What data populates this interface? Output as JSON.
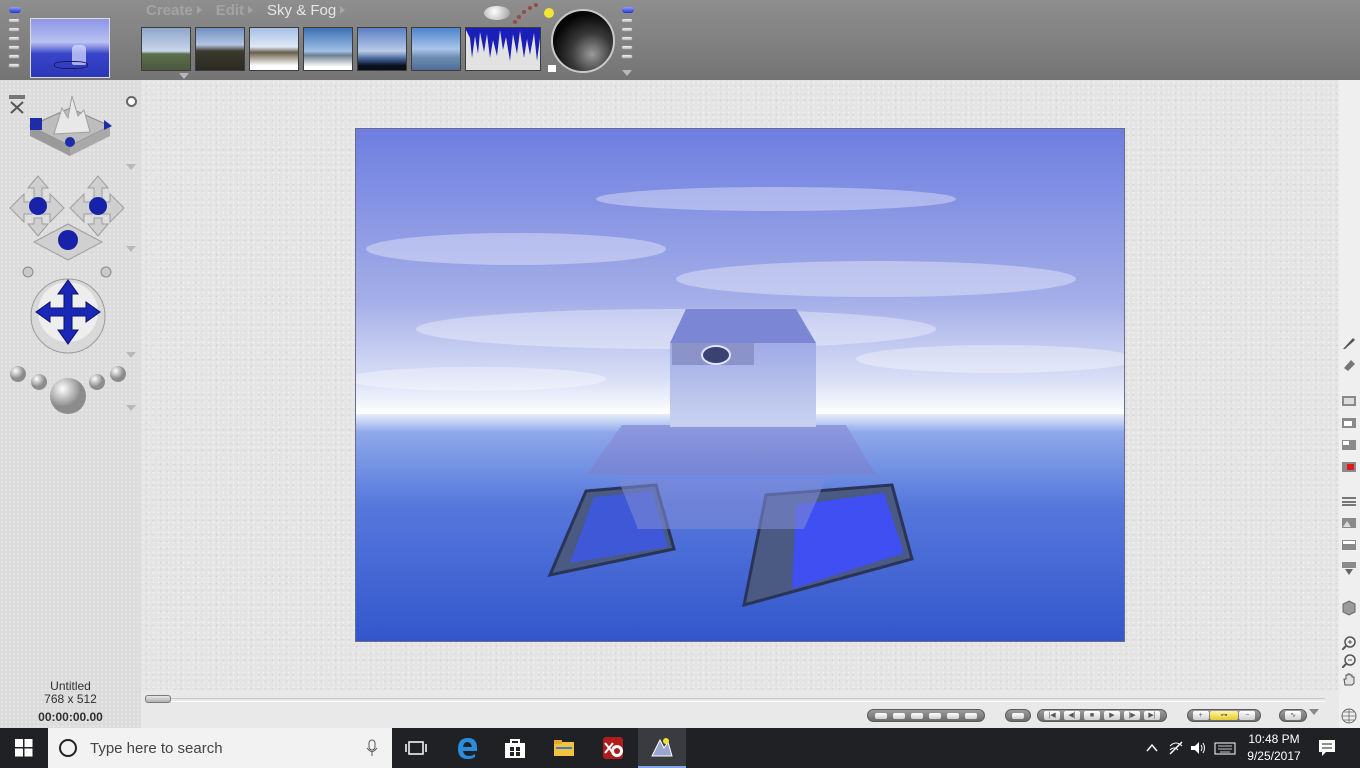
{
  "menu": [
    {
      "label": "Create",
      "active": false
    },
    {
      "label": "Edit",
      "active": false
    },
    {
      "label": "Sky & Fog",
      "active": true
    }
  ],
  "presets": [
    {
      "name": "preset-1",
      "sky": "#8fa6c8",
      "ground": "#5d6e4c"
    },
    {
      "name": "preset-2",
      "sky": "#6f8fc0",
      "ground": "#3d3a2e"
    },
    {
      "name": "preset-3",
      "sky": "#a6c0e8",
      "ground": "#6a5f4c"
    },
    {
      "name": "preset-4",
      "sky": "#3f6fb4",
      "ground": "#cfd8e6"
    },
    {
      "name": "preset-5",
      "sky": "#5b7fc4",
      "ground": "#1e2f4e"
    },
    {
      "name": "preset-6",
      "sky": "#4e83cc",
      "ground": "#6c8cb0"
    }
  ],
  "document": {
    "name": "Untitled",
    "size": "768 x 512",
    "time": "00:00:00.00"
  },
  "taskbar": {
    "search_placeholder": "Type here to search",
    "time": "10:48 PM",
    "date": "9/25/2017"
  },
  "colors": {
    "accent_blue": "#1f2fc0",
    "sky_top": "#6c7de0",
    "horizon": "#ffffff",
    "sea": "#3c5bd0",
    "sun": "#f3e533"
  }
}
